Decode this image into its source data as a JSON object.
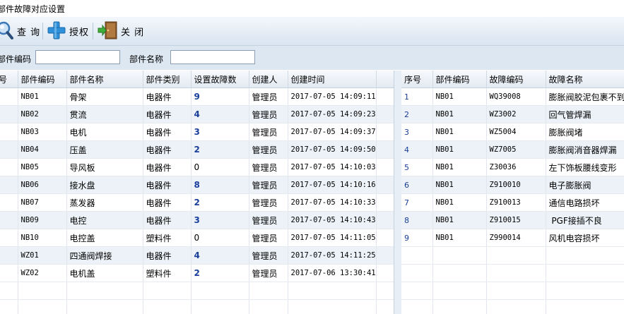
{
  "window": {
    "title": "部件故障对应设置"
  },
  "toolbar": {
    "query_label": "查 询",
    "authorize_label": "授权",
    "close_label": "关 闭"
  },
  "search": {
    "code_label": "部件编码",
    "code_value": "",
    "name_label": "部件名称",
    "name_value": ""
  },
  "left_grid": {
    "headers": [
      "号",
      "部件编码",
      "部件名称",
      "部件类别",
      "设置故障数",
      "创建人",
      "创建时间"
    ],
    "rows": [
      {
        "code": "NB01",
        "name": "骨架",
        "category": "电器件",
        "count": "9",
        "creator": "管理员",
        "time": "2017-07-05 14:09:11"
      },
      {
        "code": "NB02",
        "name": "贯流",
        "category": "电器件",
        "count": "4",
        "creator": "管理员",
        "time": "2017-07-05 14:09:23"
      },
      {
        "code": "NB03",
        "name": "电机",
        "category": "电器件",
        "count": "3",
        "creator": "管理员",
        "time": "2017-07-05 14:09:37"
      },
      {
        "code": "NB04",
        "name": "压盖",
        "category": "电器件",
        "count": "2",
        "creator": "管理员",
        "time": "2017-07-05 14:09:50"
      },
      {
        "code": "NB05",
        "name": "导风板",
        "category": "电器件",
        "count": "0",
        "creator": "管理员",
        "time": "2017-07-05 14:10:03"
      },
      {
        "code": "NB06",
        "name": "接水盘",
        "category": "电器件",
        "count": "8",
        "creator": "管理员",
        "time": "2017-07-05 14:10:16"
      },
      {
        "code": "NB07",
        "name": "蒸发器",
        "category": "电器件",
        "count": "2",
        "creator": "管理员",
        "time": "2017-07-05 14:10:33"
      },
      {
        "code": "NB09",
        "name": "电控",
        "category": "电器件",
        "count": "3",
        "creator": "管理员",
        "time": "2017-07-05 14:10:43"
      },
      {
        "code": "NB10",
        "name": "电控盖",
        "category": "塑料件",
        "count": "0",
        "creator": "管理员",
        "time": "2017-07-05 14:11:05"
      },
      {
        "code": "WZ01",
        "name": "四通阀焊接",
        "category": "电器件",
        "count": "4",
        "creator": "管理员",
        "time": "2017-07-05 14:11:25"
      },
      {
        "code": "WZ02",
        "name": "电机盖",
        "category": "塑料件",
        "count": "2",
        "creator": "管理员",
        "time": "2017-07-06 13:30:41"
      }
    ]
  },
  "right_grid": {
    "headers": [
      "序号",
      "部件编码",
      "故障编码",
      "故障名称"
    ],
    "rows": [
      {
        "idx": "1",
        "part": "NB01",
        "fault_code": "WQ39008",
        "fault_name": "膨胀阀胶泥包裹不到"
      },
      {
        "idx": "2",
        "part": "NB01",
        "fault_code": "WZ3002",
        "fault_name": "回气管焊漏"
      },
      {
        "idx": "3",
        "part": "NB01",
        "fault_code": "WZ5004",
        "fault_name": "膨胀阀堵"
      },
      {
        "idx": "4",
        "part": "NB01",
        "fault_code": "WZ7005",
        "fault_name": "膨胀阀消音器焊漏"
      },
      {
        "idx": "5",
        "part": "NB01",
        "fault_code": "Z30036",
        "fault_name": "左下饰板腰线变形"
      },
      {
        "idx": "6",
        "part": "NB01",
        "fault_code": "Z910010",
        "fault_name": "电子膨胀阀"
      },
      {
        "idx": "7",
        "part": "NB01",
        "fault_code": "Z910013",
        "fault_name": "通信电路损坏"
      },
      {
        "idx": "8",
        "part": "NB01",
        "fault_code": "Z910015",
        "fault_name": " PGF接插不良"
      },
      {
        "idx": "9",
        "part": "NB01",
        "fault_code": "Z990014",
        "fault_name": "风机电容损坏"
      }
    ]
  },
  "colors": {
    "count_text": "#1a3e9c",
    "alt_row": "#edf2f8",
    "toolbar_top": "#f3f7fb",
    "toolbar_bottom": "#d9e5f1"
  }
}
